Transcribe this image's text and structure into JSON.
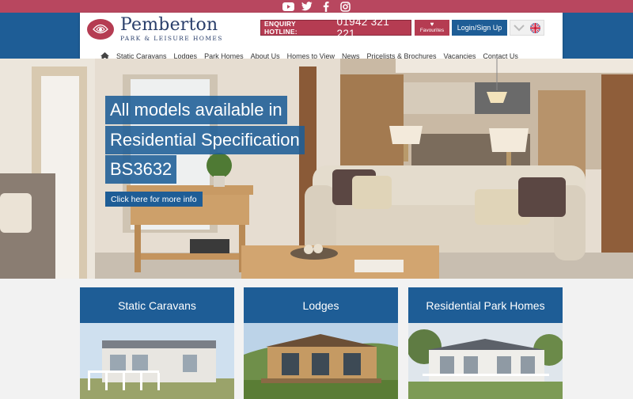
{
  "social": {
    "icons": [
      "youtube-icon",
      "twitter-icon",
      "facebook-icon",
      "instagram-icon"
    ]
  },
  "header": {
    "brand_name": "Pemberton",
    "brand_tagline": "PARK & LEISURE HOMES",
    "hotline_label": "ENQUIRY HOTLINE:",
    "hotline_number": "01942 321 221",
    "favourites_label": "Favourites",
    "login_label": "Login/Sign Up"
  },
  "nav": {
    "items": [
      "Static Caravans",
      "Lodges",
      "Park Homes",
      "About Us",
      "Homes to View",
      "News",
      "Pricelists & Brochures",
      "Vacancies",
      "Contact Us"
    ]
  },
  "hero": {
    "lines": [
      "All models available in",
      "Residential Specification",
      "BS3632"
    ],
    "cta": "Click here for more info"
  },
  "cards": [
    {
      "title": "Static Caravans"
    },
    {
      "title": "Lodges"
    },
    {
      "title": "Residential Park Homes"
    }
  ],
  "colors": {
    "brand_red": "#b53c52",
    "brand_blue": "#1e5d96",
    "social_bar": "#b8475f"
  }
}
